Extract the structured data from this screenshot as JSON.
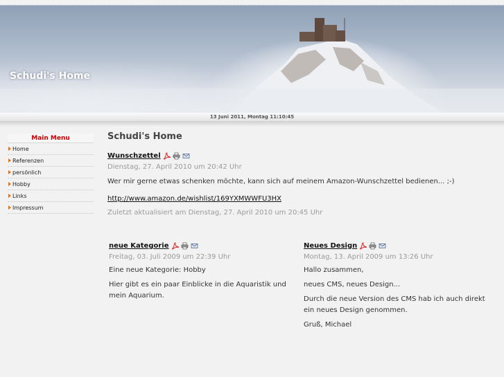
{
  "header": {
    "site_title": "Schudi's Home",
    "datetime": "13 Juni 2011, Montag 11:10:45"
  },
  "sidebar": {
    "menu_title": "Main Menu",
    "items": [
      {
        "label": "Home"
      },
      {
        "label": "Referenzen"
      },
      {
        "label": "persönlich"
      },
      {
        "label": "Hobby"
      },
      {
        "label": "Links"
      },
      {
        "label": "Impressum"
      }
    ]
  },
  "main": {
    "page_title": "Schudi's Home",
    "featured": {
      "title": "Wunschzettel",
      "date": "Dienstag, 27. April 2010 um 20:42 Uhr",
      "text": "Wer mir gerne etwas schenken möchte, kann sich auf meinem Amazon-Wunschzettel bedienen... ;-)",
      "link": "http://www.amazon.de/wishlist/169YXMWWFU3HX",
      "updated": "Zuletzt aktualisiert am Dienstag, 27. April 2010 um 20:45 Uhr"
    },
    "left_article": {
      "title": "neue Kategorie",
      "date": "Freitag, 03. Juli 2009 um 22:39 Uhr",
      "para1": "Eine neue Kategorie: Hobby",
      "para2_line1": "Hier gibt es ein paar Einblicke in die Aquaristik und",
      "para2_line2": "mein Aquarium."
    },
    "right_article": {
      "title": "Neues Design",
      "date": "Montag, 13. April 2009 um 13:26 Uhr",
      "para1": "Hallo zusammen,",
      "para2": "neues CMS, neues Design...",
      "para3_line1": "Durch die neue Version des CMS hab ich auch direkt",
      "para3_line2": "ein neues Design genommen.",
      "para4": "Gruß, Michael"
    }
  },
  "icons": {
    "pdf": "pdf-icon",
    "print": "print-icon",
    "email": "email-icon",
    "menu_arrow": "arrow-icon"
  },
  "colors": {
    "menu_title": "#cc0000",
    "menu_arrow": "#e8700a"
  }
}
